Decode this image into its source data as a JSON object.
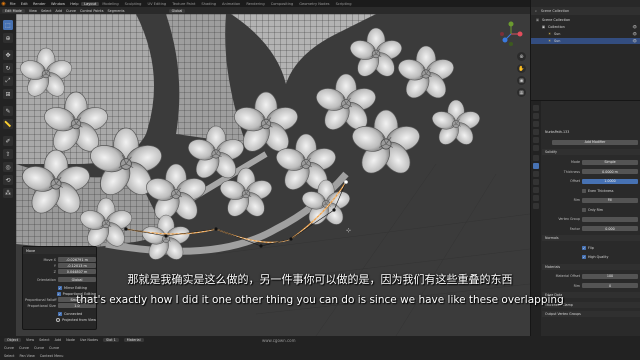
{
  "app": {
    "menu": [
      "File",
      "Edit",
      "Render",
      "Window",
      "Help"
    ],
    "workspace_tabs": [
      "Layout",
      "Modeling",
      "Sculpting",
      "UV Editing",
      "Texture Paint",
      "Shading",
      "Animation",
      "Rendering",
      "Compositing",
      "Geometry Nodes",
      "Scripting"
    ],
    "active_tab": "Layout",
    "scene": "Scene",
    "view_layer": "ViewLayer"
  },
  "viewport_header": {
    "mode": "Edit Mode",
    "view": "View",
    "select": "Select",
    "add": "Add",
    "curve": "Curve",
    "control_points": "Control Points",
    "segments": "Segments",
    "transform": "Global"
  },
  "operator_panel": {
    "title": "Move",
    "rows": [
      {
        "key": "Move X",
        "value": "-0.026791 m"
      },
      {
        "key": "Y",
        "value": "-0.12013 m"
      },
      {
        "key": "Z",
        "value": "0.044807 m"
      },
      {
        "key": "Orientation",
        "value": "Global"
      }
    ],
    "checks": [
      "Mirror Editing",
      "Proportional Editing"
    ],
    "falloff_label": "Proportional Falloff",
    "falloff": "Smooth",
    "size_label": "Proportional Size",
    "size": "1.0",
    "connected": "Connected",
    "projected": "Projected from View"
  },
  "outliner": {
    "header": "Scene Collection",
    "rows": [
      {
        "label": "Scene Collection",
        "indent": 0,
        "selected": false,
        "color": "#888888"
      },
      {
        "label": "Collection",
        "indent": 1,
        "selected": false,
        "color": "#cccccc"
      },
      {
        "label": "Sun",
        "indent": 2,
        "selected": false,
        "color": "#e5c55a"
      },
      {
        "label": "Sun",
        "indent": 2,
        "selected": true,
        "color": "#e5c55a"
      }
    ]
  },
  "properties": {
    "object_name": "NurbsPath.133",
    "add_modifier": "Add Modifier",
    "modifier_name": "Solidify",
    "rows": [
      {
        "type": "kv",
        "key": "Mode",
        "value": "Simple"
      },
      {
        "type": "kv",
        "key": "Thickness",
        "value": "0.0000 m"
      },
      {
        "type": "kv",
        "key": "Offset",
        "value": "1.0000",
        "blue": true
      },
      {
        "type": "check",
        "label": "Even Thickness",
        "on": false
      },
      {
        "type": "kv",
        "key": "Rim",
        "value": "Fill"
      },
      {
        "type": "check",
        "label": "Only Rim",
        "on": false
      },
      {
        "type": "kv",
        "key": "Vertex Group",
        "value": ""
      },
      {
        "type": "kv",
        "key": "Factor",
        "value": "0.000"
      },
      {
        "type": "section",
        "label": "Normals"
      },
      {
        "type": "check",
        "label": "Flip",
        "on": true
      },
      {
        "type": "check",
        "label": "High Quality",
        "on": true
      },
      {
        "type": "section",
        "label": "Materials"
      },
      {
        "type": "kv",
        "key": "Material Offset",
        "value": "100"
      },
      {
        "type": "kv",
        "key": "Rim",
        "value": "0"
      },
      {
        "type": "section",
        "label": "Edge Data"
      },
      {
        "type": "section",
        "label": "Thickness Clamp"
      },
      {
        "type": "section",
        "label": "Output Vertex Groups"
      }
    ]
  },
  "status_bar": {
    "row1": [
      "Object",
      "View",
      "Select",
      "Add",
      "Node",
      "Use Nodes",
      "Slot 1",
      "Material"
    ],
    "row2": [
      "Curve",
      "Curve",
      "Curve",
      "Curve"
    ],
    "row3": [
      "Select",
      "Pan View",
      "Context Menu"
    ]
  },
  "subtitles": {
    "cn": "那就是我确实是这么做的，另一件事你可以做的是，因为我们有这些重叠的东西",
    "en": "that's exactly how I did it one other thing you can do is since we have like these overlapping"
  },
  "watermark": "www.cgown.com"
}
